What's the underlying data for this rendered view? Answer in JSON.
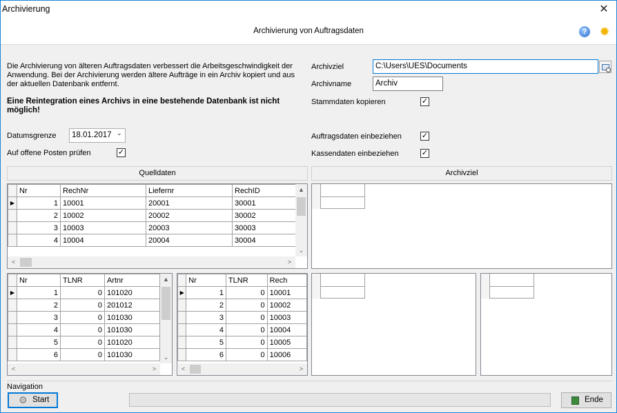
{
  "window": {
    "title": "Archivierung",
    "close_glyph": "✕"
  },
  "header": {
    "title": "Archivierung von Auftragsdaten",
    "help_icon": "help-icon",
    "settings_icon": "sun-icon"
  },
  "description": "Die Archivierung von älteren Auftragsdaten verbessert die Arbeitsgeschwindigkeit der Anwendung. Bei der Archivierung werden ältere Aufträge in ein Archiv kopiert und aus der aktuellen Datenbank entfernt.",
  "warning": "Eine Reintegration eines Archivs in eine bestehende Datenbank ist nicht möglich!",
  "form": {
    "datumsgrenze_label": "Datumsgrenze",
    "datumsgrenze_value": "18.01.2017",
    "offene_posten_label": "Auf offene Posten prüfen",
    "offene_posten_checked": true,
    "archivziel_label": "Archivziel",
    "archivziel_value": "C:\\Users\\UES\\Documents",
    "archivname_label": "Archivname",
    "archivname_value": "Archiv",
    "stammdaten_label": "Stammdaten kopieren",
    "stammdaten_checked": true,
    "auftragsdaten_label": "Auftragsdaten einbeziehen",
    "auftragsdaten_checked": true,
    "kassendaten_label": "Kassendaten einbeziehen",
    "kassendaten_checked": true,
    "check_glyph": "✓"
  },
  "panels": {
    "quelldaten": "Quelldaten",
    "archivziel": "Archivziel"
  },
  "grid_main": {
    "columns": [
      "Nr",
      "RechNr",
      "Liefernr",
      "RechID"
    ],
    "rows": [
      [
        "1",
        "10001",
        "20001",
        "30001"
      ],
      [
        "2",
        "10002",
        "20002",
        "30002"
      ],
      [
        "3",
        "10003",
        "20003",
        "30003"
      ],
      [
        "4",
        "10004",
        "20004",
        "30004"
      ]
    ]
  },
  "grid_left": {
    "columns": [
      "Nr",
      "TLNR",
      "Artnr"
    ],
    "rows": [
      [
        "1",
        "0",
        "101020"
      ],
      [
        "2",
        "0",
        "201012"
      ],
      [
        "3",
        "0",
        "101030"
      ],
      [
        "4",
        "0",
        "101030"
      ],
      [
        "5",
        "0",
        "101020"
      ],
      [
        "6",
        "0",
        "101030"
      ]
    ]
  },
  "grid_mid": {
    "columns": [
      "Nr",
      "TLNR",
      "Rech"
    ],
    "rows": [
      [
        "1",
        "0",
        "10001"
      ],
      [
        "2",
        "0",
        "10002"
      ],
      [
        "3",
        "0",
        "10003"
      ],
      [
        "4",
        "0",
        "10004"
      ],
      [
        "5",
        "0",
        "10005"
      ],
      [
        "6",
        "0",
        "10006"
      ]
    ]
  },
  "navigation": {
    "label": "Navigation",
    "start_label": "Start",
    "ende_label": "Ende",
    "start_icon": "gear-icon",
    "ende_icon": "exit-door-icon"
  },
  "scroll_glyphs": {
    "up": "▲",
    "down": "⌄",
    "left": "<",
    "right": ">"
  }
}
